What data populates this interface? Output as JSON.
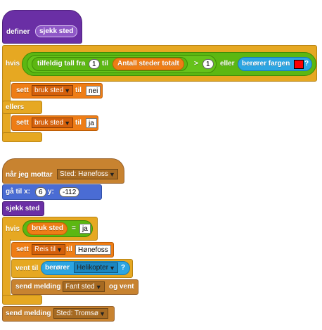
{
  "script1": {
    "define_label": "definer",
    "define_name": "sjekk sted",
    "if_label": "hvis",
    "random_label_prefix": "tilfeldig tall fra",
    "random_from": "1",
    "random_to_label": "til",
    "reporter_label": "Antall steder totalt",
    "gt_symbol": ">",
    "compare_value": "1",
    "or_label": "eller",
    "touching_color_label": "berører fargen",
    "touching_color_value": "#ff0000",
    "question_mark": "?",
    "set1_label": "sett",
    "set1_var": "bruk sted",
    "set1_to": "til",
    "set1_value": "nei",
    "else_label": "ellers",
    "set2_label": "sett",
    "set2_var": "bruk sted",
    "set2_to": "til",
    "set2_value": "ja"
  },
  "script2": {
    "receive_label": "når jeg mottar",
    "receive_message": "Sted: Hønefoss",
    "goto_label": "gå til x:",
    "goto_x": "6",
    "goto_y_label": "y:",
    "goto_y": "-112",
    "call_label": "sjekk sted",
    "if_label": "hvis",
    "var_reporter": "bruk sted",
    "eq_symbol": "=",
    "eq_value": "ja",
    "set_label": "sett",
    "set_var": "Reis til",
    "set_to": "til",
    "set_value": "Hønefoss",
    "wait_label": "vent til",
    "touching_label": "berører",
    "touching_target": "Helikopter",
    "question_mark": "?",
    "broadcast_wait_label": "send melding",
    "broadcast_wait_message": "Fant sted",
    "broadcast_wait_suffix": "og vent",
    "broadcast_label": "send melding",
    "broadcast_message": "Sted: Tromsø"
  },
  "colors": {
    "custom_block": "#6a2fa5",
    "control": "#e6a822",
    "variables": "#ee7d16",
    "motion": "#4a6cd4",
    "sensing": "#2ca5e2",
    "operators": "#5cb712",
    "events": "#c88330"
  }
}
